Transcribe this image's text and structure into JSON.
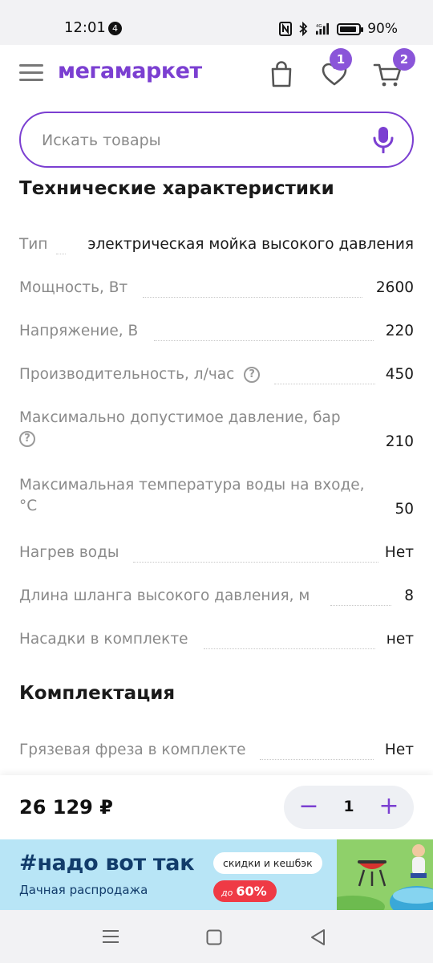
{
  "status_bar": {
    "time": "12:01",
    "notification_count": "4",
    "battery_percent": "90%",
    "battery_level": 0.9,
    "network_label": "4G"
  },
  "header": {
    "logo": "мегамаркет",
    "favorites_count": "1",
    "cart_count": "2",
    "icons": [
      "menu-icon",
      "shopping-bag-icon",
      "heart-icon",
      "cart-icon"
    ]
  },
  "search": {
    "placeholder": "Искать товары",
    "value": ""
  },
  "specs": {
    "title": "Технические характеристики",
    "rows": [
      {
        "label": "Тип",
        "value": "электрическая мойка высокого давления"
      },
      {
        "label": "Мощность, Вт",
        "value": "2600"
      },
      {
        "label": "Напряжение, В",
        "value": "220"
      },
      {
        "label": "Производительность, л/час",
        "value": "450"
      },
      {
        "label": "Максимально допустимое давление, бар",
        "value": "210"
      },
      {
        "label": "Максимальная температура воды на входе,",
        "label_line2": "°С",
        "value": "50"
      },
      {
        "label": "Нагрев воды",
        "value": "Нет"
      },
      {
        "label": "Длина шланга высокого давления, м",
        "value": "8"
      },
      {
        "label": "Насадки в комплекте",
        "value": "нет"
      }
    ]
  },
  "kit": {
    "title": "Комплектация",
    "rows": [
      {
        "label": "Грязевая фреза в комплекте",
        "value": "Нет"
      }
    ]
  },
  "buy_bar": {
    "price": "26 129 ₽",
    "quantity": "1",
    "minus": "−",
    "plus": "+"
  },
  "banner": {
    "hashtag": "#надо вот так",
    "subtitle": "Дачная распродажа",
    "tag_white": "скидки и кешбэк",
    "tag_red_prefix": "до",
    "tag_red": "60%"
  },
  "colors": {
    "brand": "#7b3fd1",
    "badge": "#8a55d9",
    "banner_bg": "#b8e5f6",
    "sale_red": "#ef3a45"
  }
}
